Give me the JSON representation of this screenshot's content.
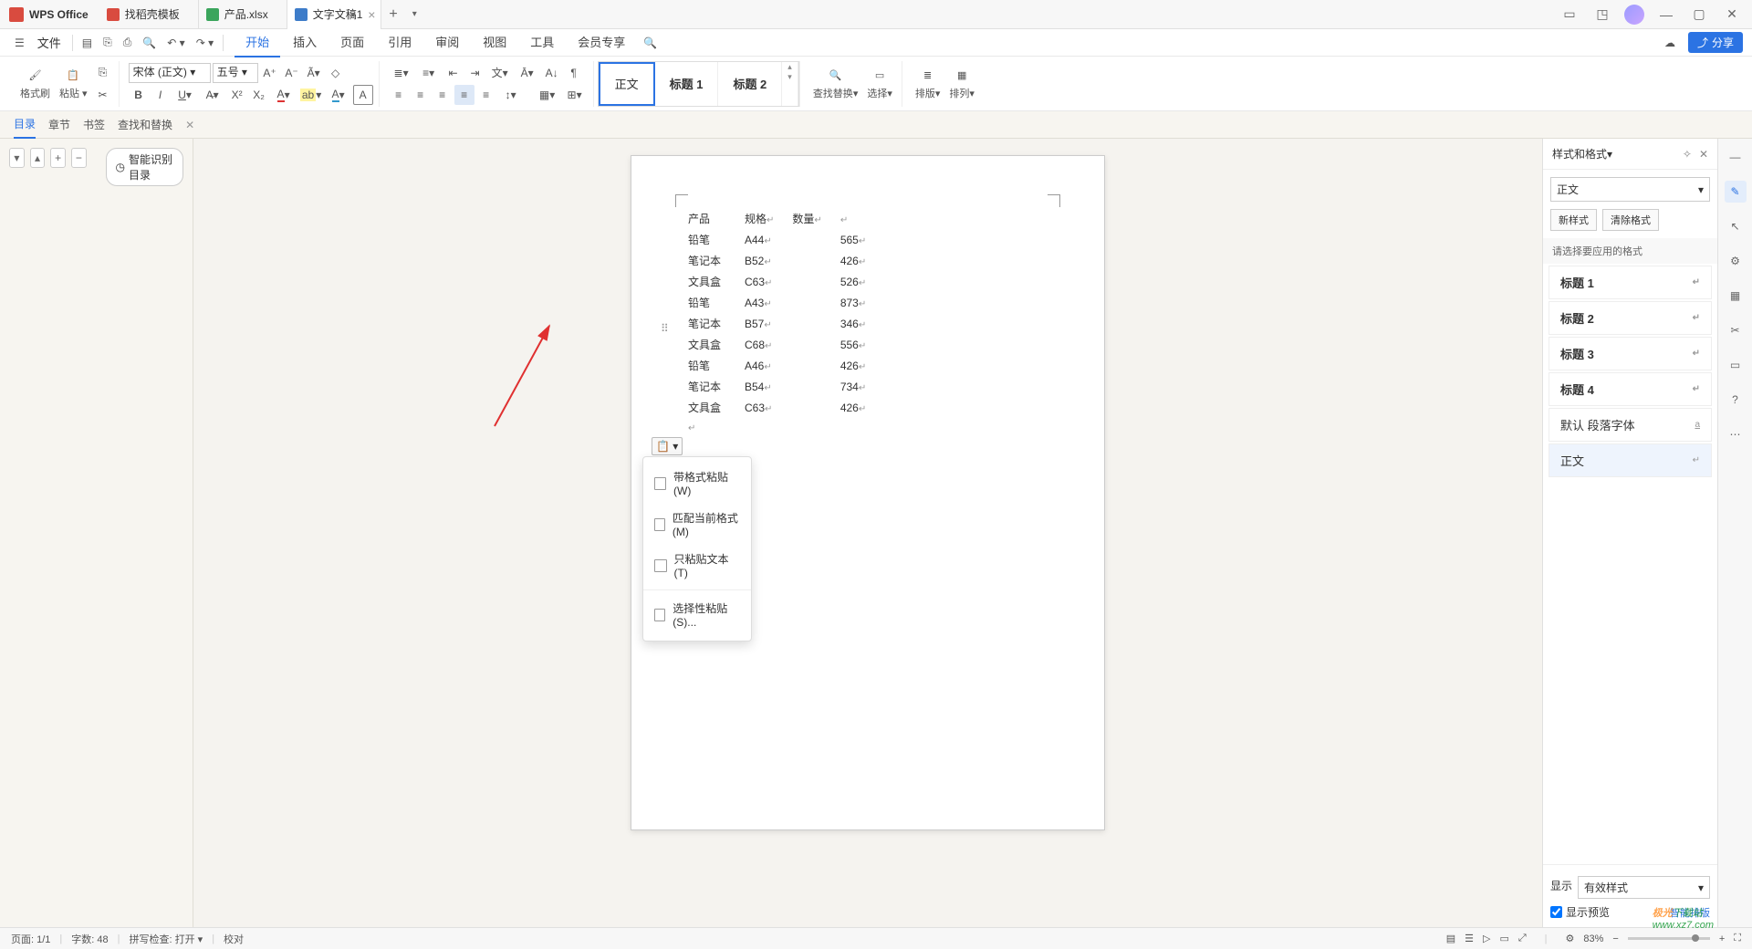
{
  "app_name": "WPS Office",
  "tabs": [
    {
      "label": "找稻壳模板"
    },
    {
      "label": "产品.xlsx"
    },
    {
      "label": "文字文稿1",
      "active": true
    }
  ],
  "menubar": {
    "file": "文件",
    "tabs": [
      "开始",
      "插入",
      "页面",
      "引用",
      "审阅",
      "视图",
      "工具",
      "会员专享"
    ],
    "active": "开始"
  },
  "share_label": "分享",
  "ribbon": {
    "format_painter": "格式刷",
    "paste": "粘贴",
    "font_name": "宋体 (正文)",
    "font_size": "五号",
    "styles": {
      "body": "正文",
      "h1": "标题 1",
      "h2": "标题 2"
    },
    "find_replace": "查找替换",
    "select": "选择",
    "layout": "排版",
    "arrange": "排列"
  },
  "subnav": {
    "items": [
      "目录",
      "章节",
      "书签",
      "查找和替换"
    ],
    "active": "目录"
  },
  "outline_smart": "智能识别目录",
  "doc": {
    "headers": [
      "产品",
      "规格",
      "数量"
    ],
    "rows": [
      [
        "铅笔",
        "A44",
        "565"
      ],
      [
        "笔记本",
        "B52",
        "426"
      ],
      [
        "文具盒",
        "C63",
        "526"
      ],
      [
        "铅笔",
        "A43",
        "873"
      ],
      [
        "笔记本",
        "B57",
        "346"
      ],
      [
        "文具盒",
        "C68",
        "556"
      ],
      [
        "铅笔",
        "A46",
        "426"
      ],
      [
        "笔记本",
        "B54",
        "734"
      ],
      [
        "文具盒",
        "C63",
        "426"
      ]
    ]
  },
  "paste_menu": {
    "keep_format": "带格式粘贴(W)",
    "match_format": "匹配当前格式(M)",
    "text_only": "只粘贴文本(T)",
    "paste_special": "选择性粘贴(S)..."
  },
  "styles_panel": {
    "title": "样式和格式",
    "current": "正文",
    "new_style": "新样式",
    "clear_format": "清除格式",
    "prompt": "请选择要应用的格式",
    "items": [
      "标题 1",
      "标题 2",
      "标题 3",
      "标题 4",
      "默认 段落字体",
      "正文"
    ],
    "display_label": "显示",
    "display_value": "有效样式",
    "preview": "显示预览",
    "smart_layout": "智能排版"
  },
  "statusbar": {
    "page": "页面: 1/1",
    "words": "字数: 48",
    "spell": "拼写检查: 打开",
    "proof": "校对",
    "zoom": "83%"
  },
  "watermark": {
    "brand": "极光",
    "text": "下载站",
    "url": "www.xz7.com"
  }
}
